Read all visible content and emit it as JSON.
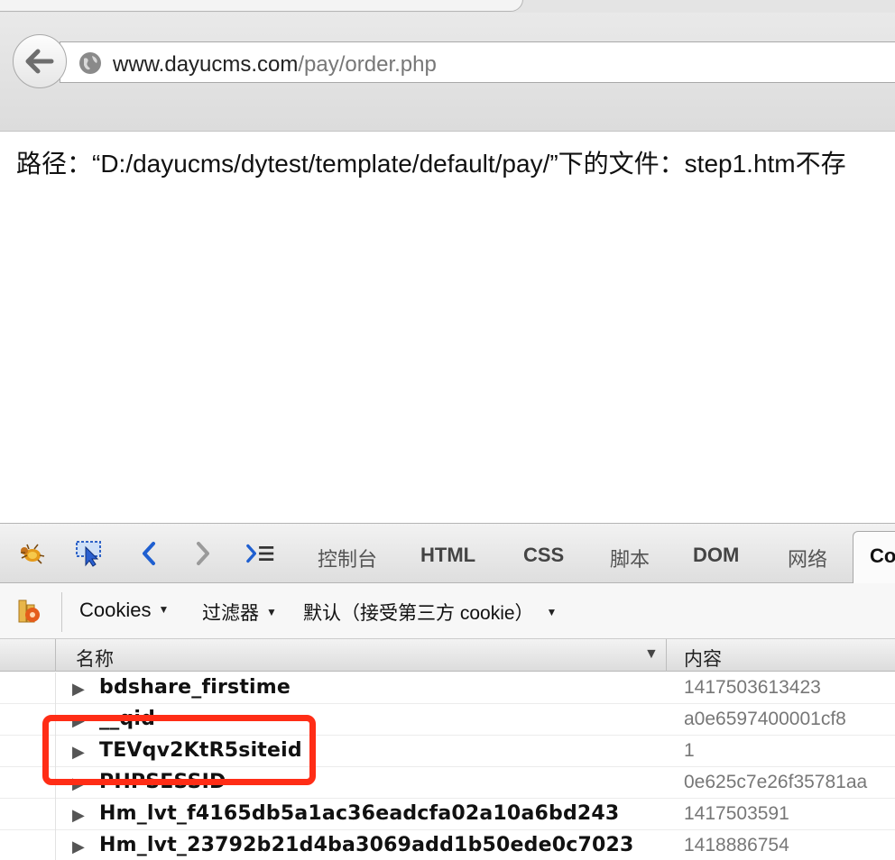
{
  "browser": {
    "url_host": "www.dayucms.com",
    "url_path": "/pay/order.php"
  },
  "page": {
    "message": "路径：“D:/dayucms/dytest/template/default/pay/”下的文件：step1.htm不存"
  },
  "devtools": {
    "tabs": [
      "控制台",
      "HTML",
      "CSS",
      "脚本",
      "DOM",
      "网络"
    ],
    "active_tab": "Co",
    "subbar": {
      "cookies": "Cookies",
      "filter": "过滤器",
      "mode": "默认（接受第三方 cookie）"
    },
    "columns": {
      "name": "名称",
      "content": "内容"
    },
    "rows": [
      {
        "name": "bdshare_firstime",
        "value": "1417503613423"
      },
      {
        "name": "__qid",
        "value": "a0e6597400001cf8"
      },
      {
        "name": "TEVqv2KtR5siteid",
        "value": "1"
      },
      {
        "name": "PHPSESSID",
        "value": "0e625c7e26f35781aa"
      },
      {
        "name": "Hm_lvt_f4165db5a1ac36eadcfa02a10a6bd243",
        "value": "1417503591"
      },
      {
        "name": "Hm_lvt_23792b21d4ba3069add1b50ede0c7023",
        "value": "1418886754"
      }
    ]
  },
  "colors": {
    "highlight": "#ff2d16",
    "nav_blue": "#1f5fd0"
  }
}
